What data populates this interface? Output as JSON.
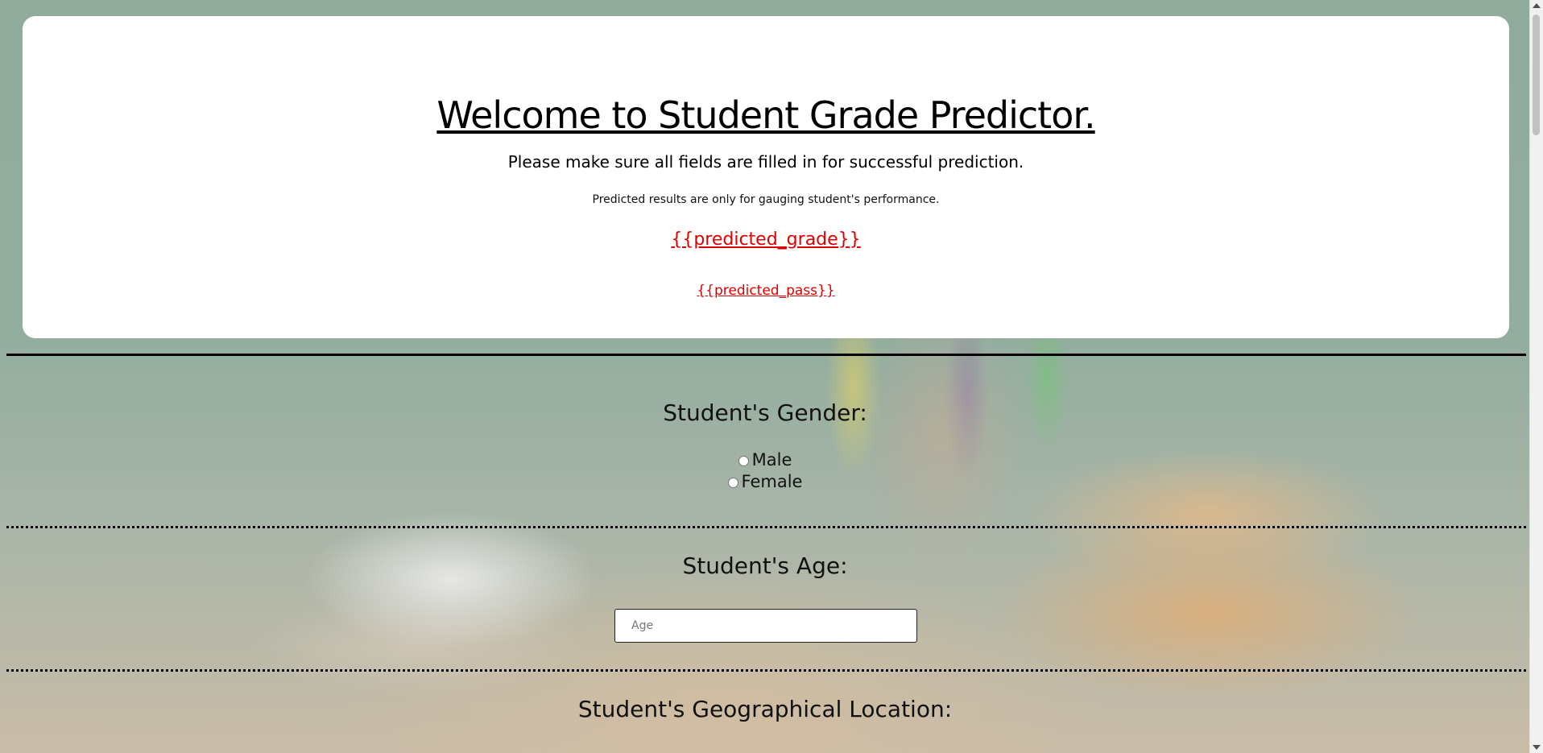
{
  "header": {
    "title": "Welcome to Student Grade Predictor.",
    "subtitle": "Please make sure all fields are filled in for successful prediction.",
    "note": "Predicted results are only for gauging student's performance.",
    "predicted_grade": "{{predicted_grade}}",
    "predicted_pass": "{{predicted_pass}}"
  },
  "form": {
    "gender": {
      "label": "Student's Gender:",
      "options": [
        "Male",
        "Female"
      ]
    },
    "age": {
      "label": "Student's Age:",
      "placeholder": "Age",
      "value": ""
    },
    "location": {
      "label": "Student's Geographical Location:"
    }
  },
  "colors": {
    "prediction_text": "#e00000",
    "card_background": "#ffffff"
  }
}
